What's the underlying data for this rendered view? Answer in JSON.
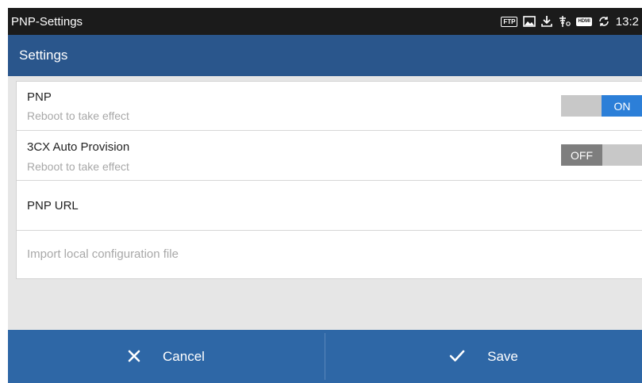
{
  "status_bar": {
    "app_name": "PNP-Settings",
    "time": "13:2",
    "icons": [
      "ftp-icon",
      "picture-icon",
      "download-icon",
      "usb-icon",
      "hdmi-icon",
      "sync-icon"
    ],
    "ftp_label": "FTP",
    "hdmi_label": "HDMI"
  },
  "header": {
    "title": "Settings"
  },
  "settings": {
    "pnp": {
      "title": "PNP",
      "subtitle": "Reboot to take effect",
      "toggle_label": "ON",
      "enabled": true
    },
    "auto_provision": {
      "title": "3CX Auto Provision",
      "subtitle": "Reboot to take effect",
      "toggle_label": "OFF",
      "enabled": false
    },
    "pnp_url": {
      "title": "PNP URL"
    },
    "import": {
      "title": "Import local configuration file"
    }
  },
  "actions": {
    "cancel_label": "Cancel",
    "save_label": "Save"
  },
  "colors": {
    "header": "#2a568c",
    "bottom_bar": "#2e67a6",
    "toggle_on": "#2c7fd8",
    "toggle_off": "#7e7e7e",
    "status_bar": "#1b1b1b"
  }
}
